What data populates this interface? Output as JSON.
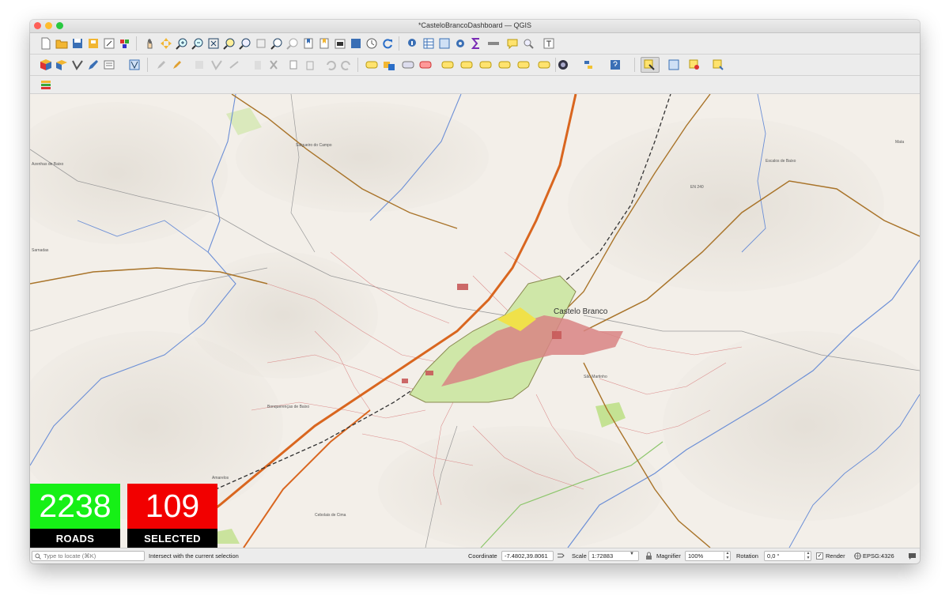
{
  "window": {
    "title": "*CasteloBrancoDashboard — QGIS"
  },
  "toolbars": {
    "row1": [
      "new-project-icon",
      "open-project-icon",
      "save-project-icon",
      "save-as-icon",
      "print-layout-icon",
      "style-manager-icon",
      "pan-hand-icon",
      "pan-to-selection-icon",
      "zoom-in-icon",
      "zoom-out-icon",
      "zoom-full-icon",
      "zoom-to-selection-icon",
      "zoom-to-layer-icon",
      "zoom-native-icon",
      "zoom-last-icon",
      "zoom-next-icon",
      "new-bookmark-icon",
      "show-bookmarks-icon",
      "temporal-controller-icon",
      "refresh-icon",
      "identify-icon",
      "attribute-table-icon",
      "statistics-icon",
      "settings-gear-icon",
      "sum-icon",
      "measure-icon",
      "map-tips-icon",
      "search-icon",
      "text-annotation-icon"
    ],
    "row2": [
      "data-source-manager-icon",
      "new-layer-icon",
      "digitize-icon",
      "edit-pencil-icon",
      "layer-properties-icon",
      "vector-layer-icon",
      "toggle-edit-icon",
      "save-edits-icon",
      "add-feature-icon",
      "move-feature-icon",
      "node-tool-icon",
      "delete-selected-icon",
      "cut-icon",
      "copy-icon",
      "paste-icon",
      "undo-icon",
      "redo-icon",
      "label-tool-icon",
      "label-highlight-icon",
      "label-pin-icon",
      "label-show-icon",
      "label-move-icon",
      "label-rotate-icon",
      "label-change-icon",
      "label-options-icon",
      "python-plugin-icon",
      "python-console-icon",
      "help-icon",
      "select-features-icon",
      "select-by-value-icon",
      "deselect-icon",
      "select-location-icon"
    ],
    "row3": [
      "layer-stack-icon"
    ]
  },
  "counters": {
    "roads": {
      "value": "2238",
      "label": "ROADS",
      "color": "#16f016"
    },
    "selected": {
      "value": "109",
      "label": "SELECTED",
      "color": "#f20000"
    }
  },
  "map": {
    "labels": {
      "castelo_branco": "Castelo Branco",
      "salgueiro": "Salgueiro do Campo",
      "escalos": "Escalos de Baixo",
      "mata": "Mata",
      "azinhas": "Azenhas de Baixo",
      "sarnadas": "Sarnadas",
      "bonquerencas": "Bonquerenças de Baixo",
      "amarelos": "Amarelos",
      "cebolais": "Cebolais de Cima",
      "en240": "EN 240",
      "sao_martinho": "São Martinho"
    }
  },
  "statusbar": {
    "locate_placeholder": "Type to locate (⌘K)",
    "message": "Intersect with the current selection",
    "coordinate_label": "Coordinate",
    "coordinate_value": "-7.4802,39.8061",
    "scale_label": "Scale",
    "scale_value": "1:72883",
    "magnifier_label": "Magnifier",
    "magnifier_value": "100%",
    "rotation_label": "Rotation",
    "rotation_value": "0,0 °",
    "render_label": "Render",
    "crs": "EPSG:4326"
  }
}
